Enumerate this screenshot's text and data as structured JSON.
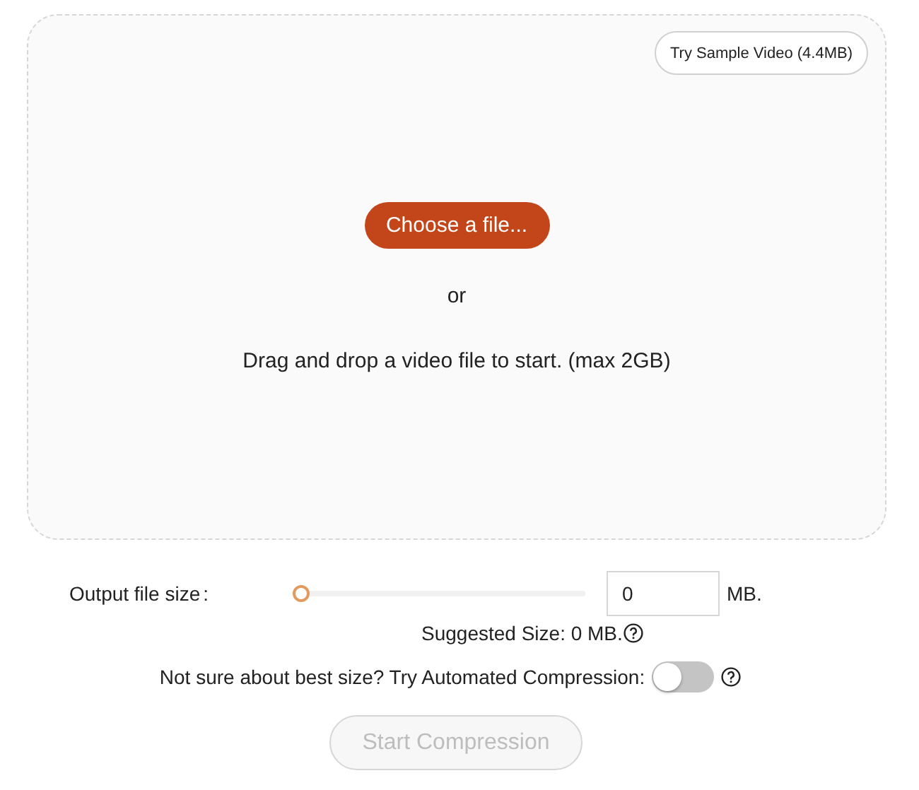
{
  "dropzone": {
    "sample_button": "Try Sample Video (4.4MB)",
    "choose_button": "Choose a file...",
    "or_text": "or",
    "hint": "Drag and drop a video file to start. (max 2GB)"
  },
  "output_size": {
    "label": "Output file size",
    "colon": ":",
    "level": 0,
    "value": "0",
    "unit": "MB.",
    "suggested": "Suggested Size: 0 MB."
  },
  "automated": {
    "label": "Not sure about best size? Try Automated Compression:",
    "on": false
  },
  "start_button": {
    "label": "Start Compression",
    "disabled": true
  }
}
